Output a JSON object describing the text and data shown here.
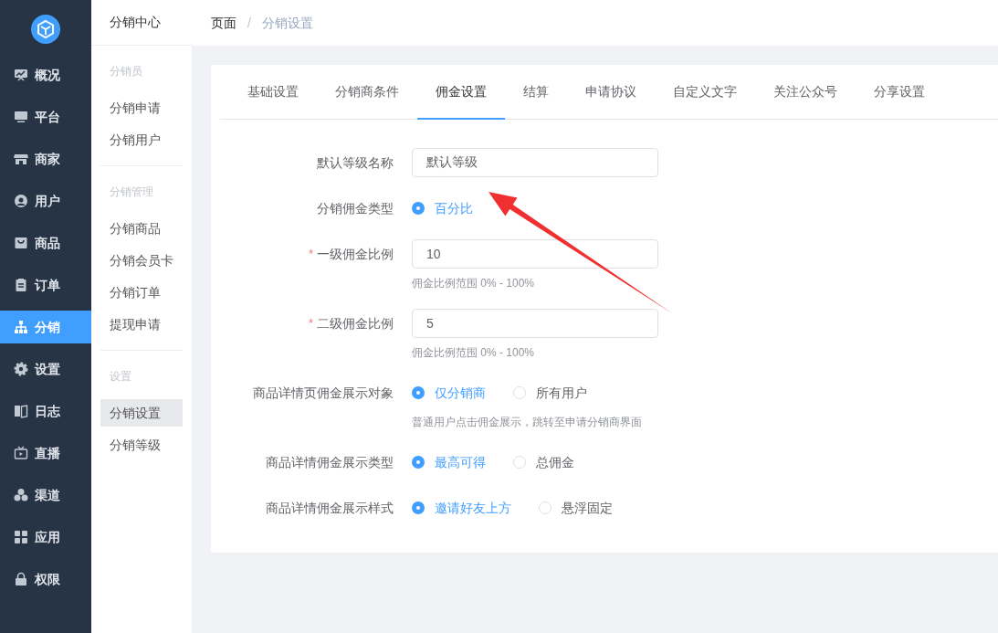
{
  "nav": [
    {
      "label": "概况",
      "selected": false
    },
    {
      "label": "平台",
      "selected": false
    },
    {
      "label": "商家",
      "selected": false
    },
    {
      "label": "用户",
      "selected": false
    },
    {
      "label": "商品",
      "selected": false
    },
    {
      "label": "订单",
      "selected": false
    },
    {
      "label": "分销",
      "selected": true
    },
    {
      "label": "设置",
      "selected": false
    },
    {
      "label": "日志",
      "selected": false
    },
    {
      "label": "直播",
      "selected": false
    },
    {
      "label": "渠道",
      "selected": false
    },
    {
      "label": "应用",
      "selected": false
    },
    {
      "label": "权限",
      "selected": false
    }
  ],
  "submenu": {
    "title": "分销中心",
    "groups": [
      {
        "heading": "分销员",
        "items": [
          {
            "label": "分销申请",
            "selected": false
          },
          {
            "label": "分销用户",
            "selected": false
          }
        ]
      },
      {
        "heading": "分销管理",
        "items": [
          {
            "label": "分销商品",
            "selected": false
          },
          {
            "label": "分销会员卡",
            "selected": false
          },
          {
            "label": "分销订单",
            "selected": false
          },
          {
            "label": "提现申请",
            "selected": false
          }
        ]
      },
      {
        "heading": "设置",
        "items": [
          {
            "label": "分销设置",
            "selected": true
          },
          {
            "label": "分销等级",
            "selected": false
          }
        ]
      }
    ]
  },
  "breadcrumb": {
    "items": [
      "页面",
      "分销设置"
    ],
    "separator": "/"
  },
  "tabs": [
    {
      "label": "基础设置",
      "selected": false
    },
    {
      "label": "分销商条件",
      "selected": false
    },
    {
      "label": "佣金设置",
      "selected": true
    },
    {
      "label": "结算",
      "selected": false
    },
    {
      "label": "申请协议",
      "selected": false
    },
    {
      "label": "自定义文字",
      "selected": false
    },
    {
      "label": "关注公众号",
      "selected": false
    },
    {
      "label": "分享设置",
      "selected": false
    }
  ],
  "form": [
    {
      "kind": "input",
      "label": "默认等级名称",
      "value": "默认等级"
    },
    {
      "kind": "radio",
      "label": "分销佣金类型",
      "options": [
        {
          "label": "百分比",
          "selected": true
        }
      ]
    },
    {
      "kind": "input",
      "label": "一级佣金比例",
      "required_mark": "*",
      "value": "10",
      "hint": "佣金比例范围 0% - 100%"
    },
    {
      "kind": "input",
      "label": "二级佣金比例",
      "required_mark": "*",
      "value": "5",
      "hint": "佣金比例范围 0% - 100%"
    },
    {
      "kind": "radio",
      "label": "商品详情页佣金展示对象",
      "options": [
        {
          "label": "仅分销商",
          "selected": true
        },
        {
          "label": "所有用户",
          "selected": false
        }
      ],
      "hint": "普通用户点击佣金展示，跳转至申请分销商界面"
    },
    {
      "kind": "radio",
      "label": "商品详情佣金展示类型",
      "options": [
        {
          "label": "最高可得",
          "selected": true
        },
        {
          "label": "总佣金",
          "selected": false
        }
      ]
    },
    {
      "kind": "radio",
      "label": "商品详情佣金展示样式",
      "options": [
        {
          "label": "邀请好友上方",
          "selected": true
        },
        {
          "label": "悬浮固定",
          "selected": false
        }
      ]
    }
  ]
}
